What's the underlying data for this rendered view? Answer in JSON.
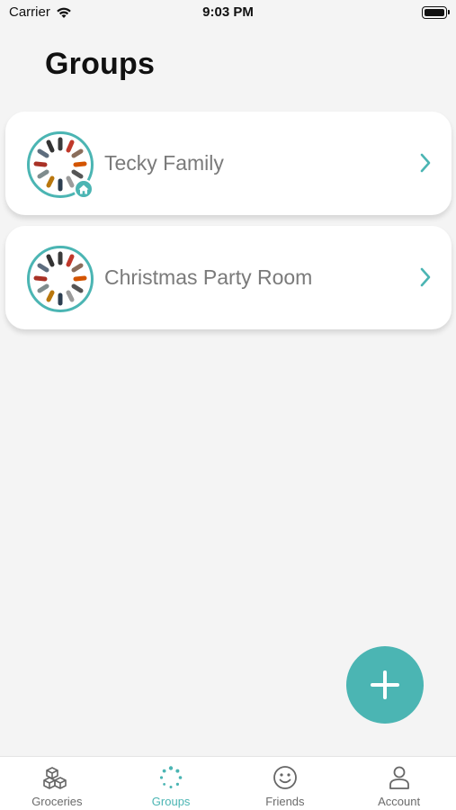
{
  "status_bar": {
    "carrier": "Carrier",
    "time": "9:03 PM"
  },
  "header": {
    "title": "Groups"
  },
  "groups": [
    {
      "name": "Tecky Family",
      "is_home": true
    },
    {
      "name": "Christmas Party Room",
      "is_home": false
    }
  ],
  "fab": {
    "icon": "plus-icon"
  },
  "tabs": [
    {
      "label": "Groceries",
      "icon": "boxes-icon",
      "active": false
    },
    {
      "label": "Groups",
      "icon": "dotted-circle-icon",
      "active": true
    },
    {
      "label": "Friends",
      "icon": "smiley-icon",
      "active": false
    },
    {
      "label": "Account",
      "icon": "person-icon",
      "active": false
    }
  ],
  "colors": {
    "accent": "#4bb5b3",
    "background": "#f4f4f4",
    "inactive": "#6b6b6b",
    "group_text": "#7a7a7a"
  }
}
